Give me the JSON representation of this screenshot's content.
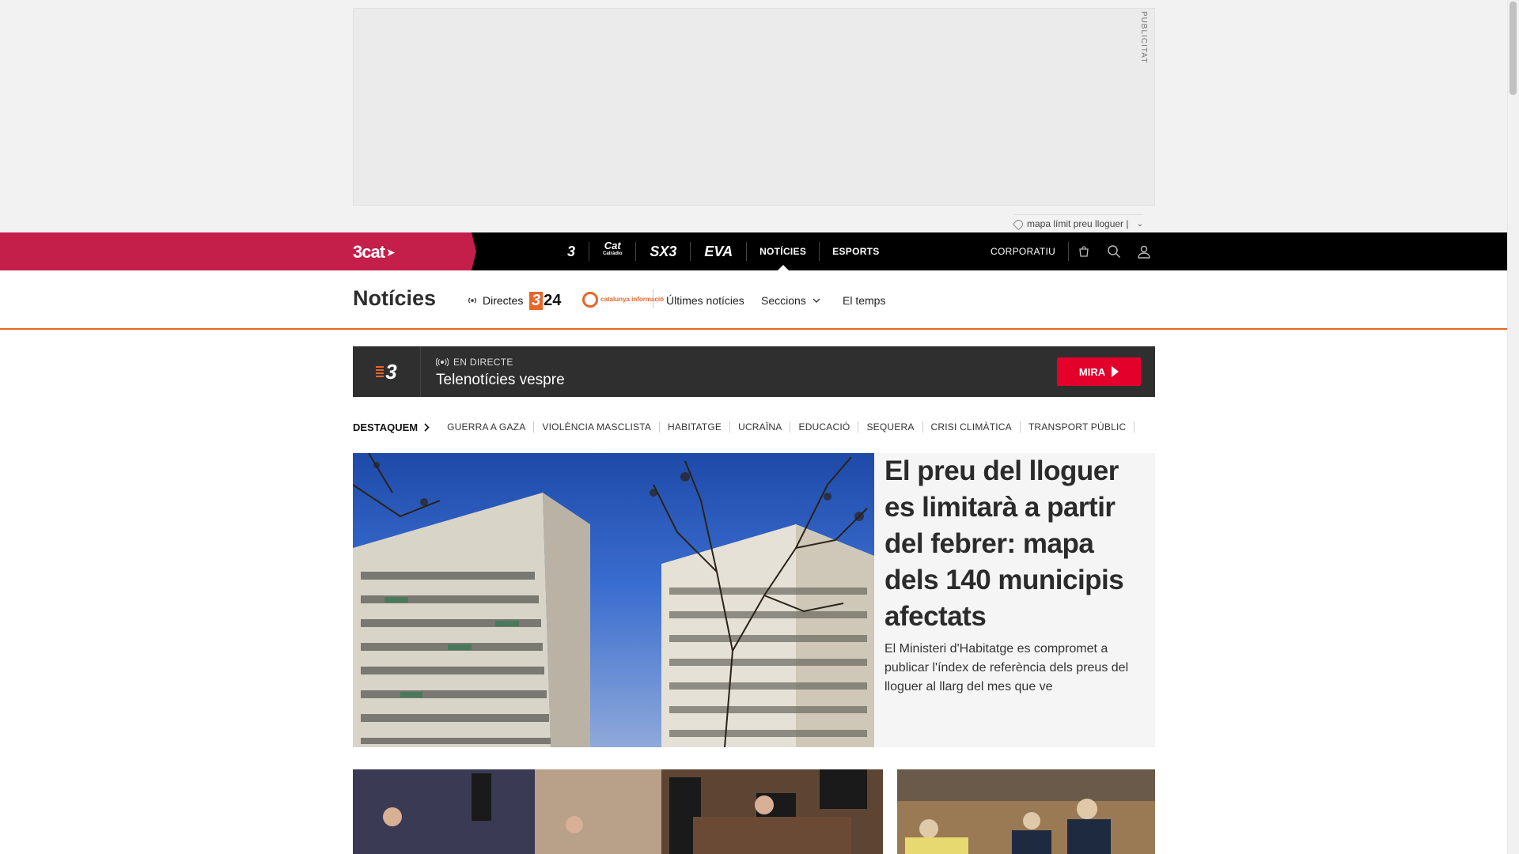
{
  "ad": {
    "tag": "PUBLICITAT",
    "keyword": "mapa límit preu lloguer |"
  },
  "topbar": {
    "brand": "3cat",
    "channels": [
      {
        "label": "3",
        "icon": "tv3-logo-icon"
      },
      {
        "label": "Cat",
        "sub": "Catràdio",
        "icon": "catradio-logo-icon"
      },
      {
        "label": "SX3",
        "icon": "sx3-logo-icon"
      },
      {
        "label": "EVA",
        "icon": "eva-logo-icon"
      }
    ],
    "nav": [
      {
        "label": "NOTÍCIES",
        "active": true
      },
      {
        "label": "ESPORTS",
        "active": false
      }
    ],
    "corporate": "CORPORATIU",
    "icons": [
      "shop-bag-icon",
      "search-icon",
      "user-icon"
    ],
    "colors": {
      "brand": "#c41e4a",
      "bar": "#000000"
    }
  },
  "section": {
    "title": "Notícies",
    "directes": "Directes",
    "logo_324": "24",
    "logo_ci": "catalunya informació",
    "links": {
      "ultimes": "Últimes notícies",
      "seccions": "Seccions",
      "temps": "El temps"
    },
    "accent": "#e8662a"
  },
  "live": {
    "channel_logo": "3",
    "tag": "EN DIRECTE",
    "title": "Telenotícies vespre",
    "button": "MIRA",
    "button_color": "#e3002b"
  },
  "destaquem": {
    "label": "DESTAQUEM",
    "items": [
      "GUERRA A GAZA",
      "VIOLÈNCIA MASCLISTA",
      "HABITATGE",
      "UCRAÏNA",
      "EDUCACIÓ",
      "SEQUERA",
      "CRISI CLIMÀTICA",
      "TRANSPORT PÚBLIC"
    ]
  },
  "lead": {
    "headline": "El preu del lloguer es limitarà a partir del febrer: mapa dels 140 municipis afectats",
    "summary": "El Ministeri d'Habitatge es compromet a publicar l'índex de referència dels preus del lloguer al llarg del mes que ve"
  }
}
